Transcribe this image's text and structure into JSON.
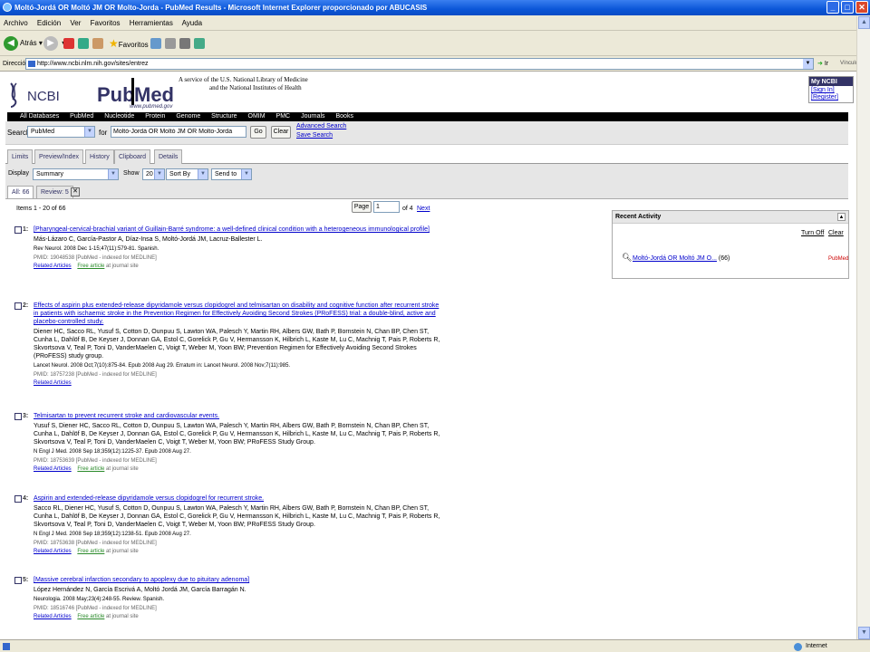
{
  "window": {
    "title": "Moltó-Jordá OR Moltó JM OR Molto-Jorda - PubMed Results - Microsoft Internet Explorer proporcionado por ABUCASIS"
  },
  "menu": [
    "Archivo",
    "Edición",
    "Ver",
    "Favoritos",
    "Herramientas",
    "Ayuda"
  ],
  "toolbar": {
    "back": "Atrás",
    "favorites": "Favoritos"
  },
  "address": {
    "label": "Dirección",
    "url": "http://www.ncbi.nlm.nih.gov/sites/entrez",
    "go": "Ir",
    "links": "Vínculos"
  },
  "header": {
    "ncbi": "NCBI",
    "pubmed_pub": "Pub",
    "pubmed_med": "Med",
    "pubmed_url": "www.pubmed.gov",
    "service_line1": "A service of the U.S. National Library of Medicine",
    "service_line2": "and the National Institutes of Health",
    "myncbi": "My NCBI",
    "signin": "[Sign In]",
    "register": "[Register]"
  },
  "nav": [
    "All Databases",
    "PubMed",
    "Nucleotide",
    "Protein",
    "Genome",
    "Structure",
    "OMIM",
    "PMC",
    "Journals",
    "Books"
  ],
  "search": {
    "label": "Search",
    "db": "PubMed",
    "for": "for",
    "query": "Moltó-Jordá OR Moltó JM OR Molto-Jorda",
    "go": "Go",
    "clear": "Clear",
    "advanced": "Advanced Search",
    "save": "Save Search"
  },
  "tabs": [
    "Limits",
    "Preview/Index",
    "History",
    "Clipboard",
    "Details"
  ],
  "display": {
    "label": "Display",
    "value": "Summary",
    "show_label": "Show",
    "show_value": "20",
    "sort": "Sort By",
    "send": "Send to"
  },
  "subtabs": {
    "all": "All: 66",
    "review": "Review: 5"
  },
  "paging": {
    "items": "Items 1 - 20 of 66",
    "page_label": "Page",
    "page_value": "1",
    "of": "of 4",
    "next": "Next"
  },
  "results": [
    {
      "num": "1:",
      "title": "[Pharyngeal-cervical-brachial variant of Guillain-Barré syndrome: a well-defined clinical condition with a heterogeneous immunological profile]",
      "authors": "Más-Lázaro C, García-Pastor A, Díaz-Insa S, Moltó-Jordá JM, Lacruz-Ballester L.",
      "source": "Rev Neurol. 2008 Dec 1-15;47(11):579-81. Spanish.",
      "pmid": "PMID: 19048538 [PubMed - indexed for MEDLINE]",
      "related": "Related Articles",
      "free": "Free article",
      "journal": " at journal site"
    },
    {
      "num": "2:",
      "title": "Effects of aspirin plus extended-release dipyridamole versus clopidogrel and telmisartan on disability and cognitive function after recurrent stroke in patients with ischaemic stroke in the Prevention Regimen for Effectively Avoiding Second Strokes (PRoFESS) trial: a double-blind, active and placebo-controlled study.",
      "authors": "Diener HC, Sacco RL, Yusuf S, Cotton D, Ounpuu S, Lawton WA, Palesch Y, Martin RH, Albers GW, Bath P, Bornstein N, Chan BP, Chen ST, Cunha L, Dahlöf B, De Keyser J, Donnan GA, Estol C, Gorelick P, Gu V, Hermansson K, Hilbrich L, Kaste M, Lu C, Machnig T, Pais P, Roberts R, Skvortsova V, Teal P, Toni D, VanderMaelen C, Voigt T, Weber M, Yoon BW; Prevention Regimen for Effectively Avoiding Second Strokes (PRoFESS) study group.",
      "source": "Lancet Neurol. 2008 Oct;7(10):875-84. Epub 2008 Aug 29. Erratum in: Lancet Neurol. 2008 Nov;7(11):985.",
      "pmid": "PMID: 18757238 [PubMed - indexed for MEDLINE]",
      "related": "Related Articles",
      "free": "",
      "journal": ""
    },
    {
      "num": "3:",
      "title": "Telmisartan to prevent recurrent stroke and cardiovascular events.",
      "authors": "Yusuf S, Diener HC, Sacco RL, Cotton D, Ounpuu S, Lawton WA, Palesch Y, Martin RH, Albers GW, Bath P, Bornstein N, Chan BP, Chen ST, Cunha L, Dahlöf B, De Keyser J, Donnan GA, Estol C, Gorelick P, Gu V, Hermansson K, Hilbrich L, Kaste M, Lu C, Machnig T, Pais P, Roberts R, Skvortsova V, Teal P, Toni D, VanderMaelen C, Voigt T, Weber M, Yoon BW; PRoFESS Study Group.",
      "source": "N Engl J Med. 2008 Sep 18;359(12):1225-37. Epub 2008 Aug 27.",
      "pmid": "PMID: 18753639 [PubMed - indexed for MEDLINE]",
      "related": "Related Articles",
      "free": "Free article",
      "journal": " at journal site"
    },
    {
      "num": "4:",
      "title": "Aspirin and extended-release dipyridamole versus clopidogrel for recurrent stroke.",
      "authors": "Sacco RL, Diener HC, Yusuf S, Cotton D, Ounpuu S, Lawton WA, Palesch Y, Martin RH, Albers GW, Bath P, Bornstein N, Chan BP, Chen ST, Cunha L, Dahlöf B, De Keyser J, Donnan GA, Estol C, Gorelick P, Gu V, Hermansson K, Hilbrich L, Kaste M, Lu C, Machnig T, Pais P, Roberts R, Skvortsova V, Teal P, Toni D, VanderMaelen C, Voigt T, Weber M, Yoon BW; PRoFESS Study Group.",
      "source": "N Engl J Med. 2008 Sep 18;359(12):1238-51. Epub 2008 Aug 27.",
      "pmid": "PMID: 18753638 [PubMed - indexed for MEDLINE]",
      "related": "Related Articles",
      "free": "Free article",
      "journal": " at journal site"
    },
    {
      "num": "5:",
      "title": "[Massive cerebral infarction secondary to apoplexy due to pituitary adenoma]",
      "authors": "López Hernández N, García Escrivá A, Moltó Jordá JM, García Barragán N.",
      "source": "Neurologia. 2008 May;23(4):248-55. Review. Spanish.",
      "pmid": "PMID: 18516746 [PubMed - indexed for MEDLINE]",
      "related": "Related Articles",
      "free": "Free article",
      "journal": " at journal site"
    }
  ],
  "recent": {
    "title": "Recent Activity",
    "turnoff": "Turn Off",
    "clear": "Clear",
    "item": "Moltó-Jordá OR Moltó JM O...",
    "count": " (66)",
    "db": "PubMed"
  },
  "status": {
    "zone": "Internet"
  }
}
